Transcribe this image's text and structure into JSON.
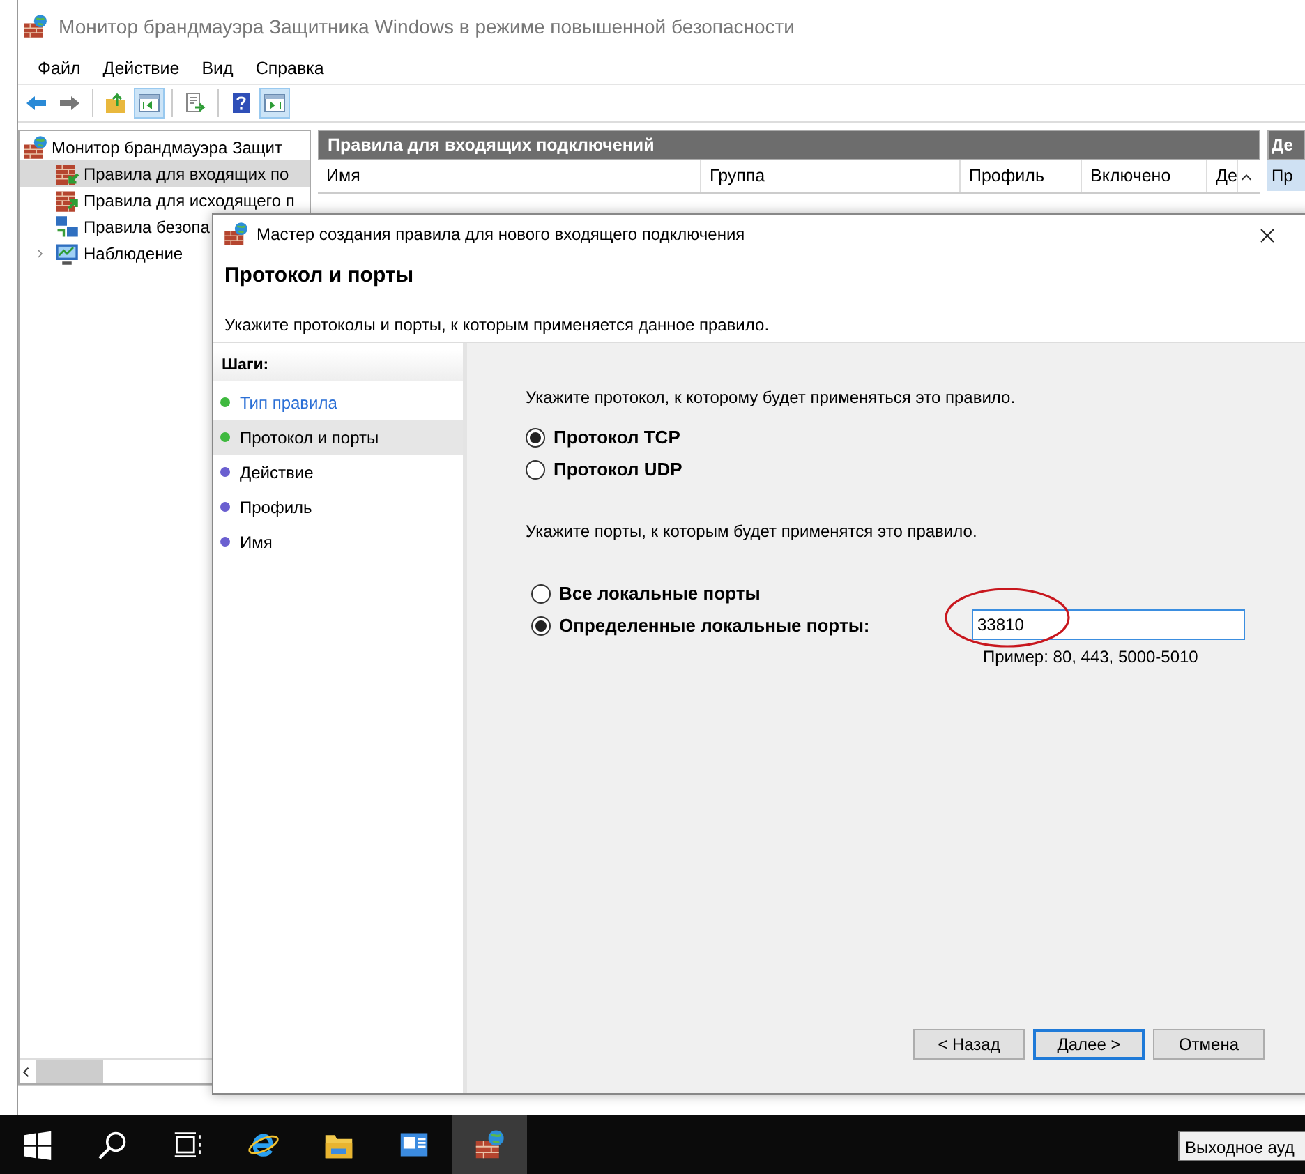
{
  "window": {
    "title": "Монитор брандмауэра Защитника Windows в режиме повышенной безопасности"
  },
  "menu": [
    "Файл",
    "Действие",
    "Вид",
    "Справка"
  ],
  "toolbar": [
    {
      "kind": "back",
      "on": false
    },
    {
      "kind": "forward",
      "on": false
    },
    {
      "kind": "separator"
    },
    {
      "kind": "up",
      "on": false
    },
    {
      "kind": "tree",
      "on": true
    },
    {
      "kind": "separator"
    },
    {
      "kind": "export",
      "on": false
    },
    {
      "kind": "separator"
    },
    {
      "kind": "help",
      "on": false
    },
    {
      "kind": "actions",
      "on": true
    }
  ],
  "tree": {
    "label": "Монитор брандмауэра Защит",
    "kind": "firewall",
    "children": [
      {
        "label": "Правила для входящих по",
        "kind": "inbound",
        "selected": true
      },
      {
        "label": "Правила для исходящего п",
        "kind": "outbound",
        "selected": false
      },
      {
        "label": "Правила безопа",
        "kind": "security",
        "selected": false
      },
      {
        "label": "Наблюдение",
        "kind": "monitor",
        "selected": false,
        "expanded": false
      }
    ]
  },
  "rules_pane": {
    "title": "Правила для входящих подключений",
    "columns": [
      "Имя",
      "Группа",
      "Профиль",
      "Включено",
      "Де"
    ]
  },
  "actions_pane": {
    "title": "Де",
    "items": [
      "Пр"
    ]
  },
  "dialog": {
    "title": "Мастер создания правила для нового входящего подключения",
    "heading": "Протокол и порты",
    "subtitle": "Укажите протоколы и порты, к которым применяется данное правило.",
    "steps_title": "Шаги:",
    "steps": [
      {
        "label": "Тип правила",
        "kind": "link",
        "color": "#3fb93f",
        "selected": false
      },
      {
        "label": "Протокол и порты",
        "kind": "plain",
        "color": "#3fb93f",
        "selected": true
      },
      {
        "label": "Действие",
        "kind": "plain",
        "color": "#6a5fd0",
        "selected": false
      },
      {
        "label": "Профиль",
        "kind": "plain",
        "color": "#6a5fd0",
        "selected": false
      },
      {
        "label": "Имя",
        "kind": "plain",
        "color": "#6a5fd0",
        "selected": false
      }
    ],
    "protocol_prompt": "Укажите протокол, к которому будет применяться это правило.",
    "protocols": [
      {
        "label": "Протокол TCP",
        "selected": true
      },
      {
        "label": "Протокол UDP",
        "selected": false
      }
    ],
    "ports_prompt": "Укажите порты, к которым будет применятся это правило.",
    "ports": [
      {
        "label": "Все локальные порты",
        "selected": false
      },
      {
        "label": "Определенные локальные порты:",
        "selected": true
      }
    ],
    "port_field": {
      "value": "33810",
      "circled": true,
      "hint": "Пример: 80, 443, 5000-5010"
    },
    "buttons": [
      {
        "label": "< Назад",
        "default": false
      },
      {
        "label": "Далее >",
        "default": true
      },
      {
        "label": "Отмена",
        "default": false
      }
    ]
  },
  "taskbar": {
    "items": [
      {
        "kind": "start",
        "active": false
      },
      {
        "kind": "search",
        "active": false
      },
      {
        "kind": "taskview",
        "active": false
      },
      {
        "kind": "browser",
        "active": false
      },
      {
        "kind": "folder",
        "active": false
      },
      {
        "kind": "server",
        "active": false
      },
      {
        "kind": "firewall",
        "active": true
      }
    ],
    "tooltip": "Выходное ауд"
  }
}
